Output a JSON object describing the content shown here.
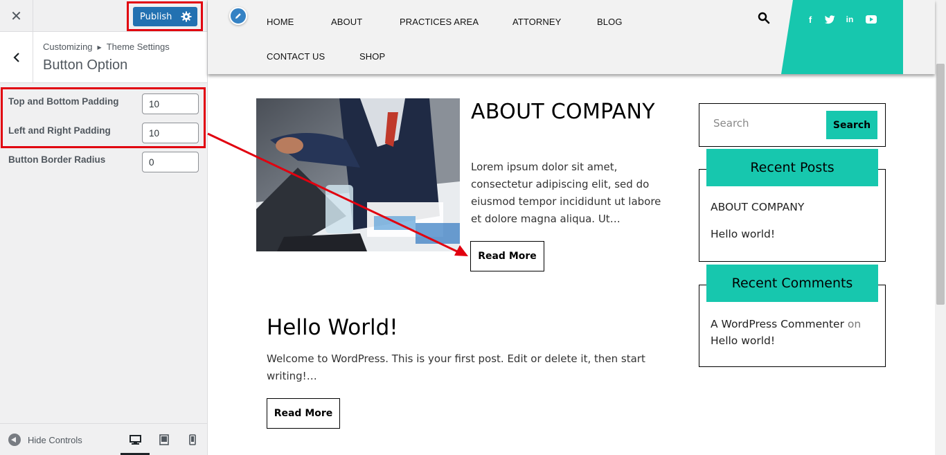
{
  "customizer": {
    "close_label": "✕",
    "publish_label": "Publish",
    "breadcrumb": {
      "root": "Customizing",
      "parent": "Theme Settings"
    },
    "section_title": "Button Option",
    "options": [
      {
        "label": "Top and Bottom Padding",
        "value": "10"
      },
      {
        "label": "Left and Right Padding",
        "value": "10"
      },
      {
        "label": "Button Border Radius",
        "value": "0"
      }
    ],
    "hide_controls_label": "Hide Controls",
    "devices": [
      "desktop-icon",
      "tablet-icon",
      "mobile-icon"
    ]
  },
  "site": {
    "nav": [
      {
        "label": "HOME"
      },
      {
        "label": "ABOUT"
      },
      {
        "label": "PRACTICES AREA"
      },
      {
        "label": "ATTORNEY"
      },
      {
        "label": "BLOG"
      },
      {
        "label": "CONTACT US"
      },
      {
        "label": "SHOP"
      }
    ],
    "social": [
      "facebook-icon",
      "twitter-icon",
      "linkedin-icon",
      "youtube-icon"
    ],
    "accent_color": "#17c7ae",
    "posts": [
      {
        "title": "ABOUT COMPANY",
        "excerpt": "Lorem ipsum dolor sit amet, consectetur adipiscing elit, sed do eiusmod tempor incididunt ut labore et dolore magna aliqua. Ut…",
        "read_more": "Read More"
      },
      {
        "title": "Hello World!",
        "excerpt": "Welcome to WordPress. This is your first post. Edit or delete it, then start writing!…",
        "read_more": "Read More"
      }
    ],
    "sidebar": {
      "search_placeholder": "Search",
      "search_button": "Search",
      "recent_posts_title": "Recent Posts",
      "recent_posts": [
        "ABOUT COMPANY",
        "Hello world!"
      ],
      "recent_comments_title": "Recent Comments",
      "comment": {
        "author": "A WordPress Commenter",
        "on": "on",
        "post": "Hello world!"
      }
    }
  },
  "annotation_color": "#e1000f"
}
